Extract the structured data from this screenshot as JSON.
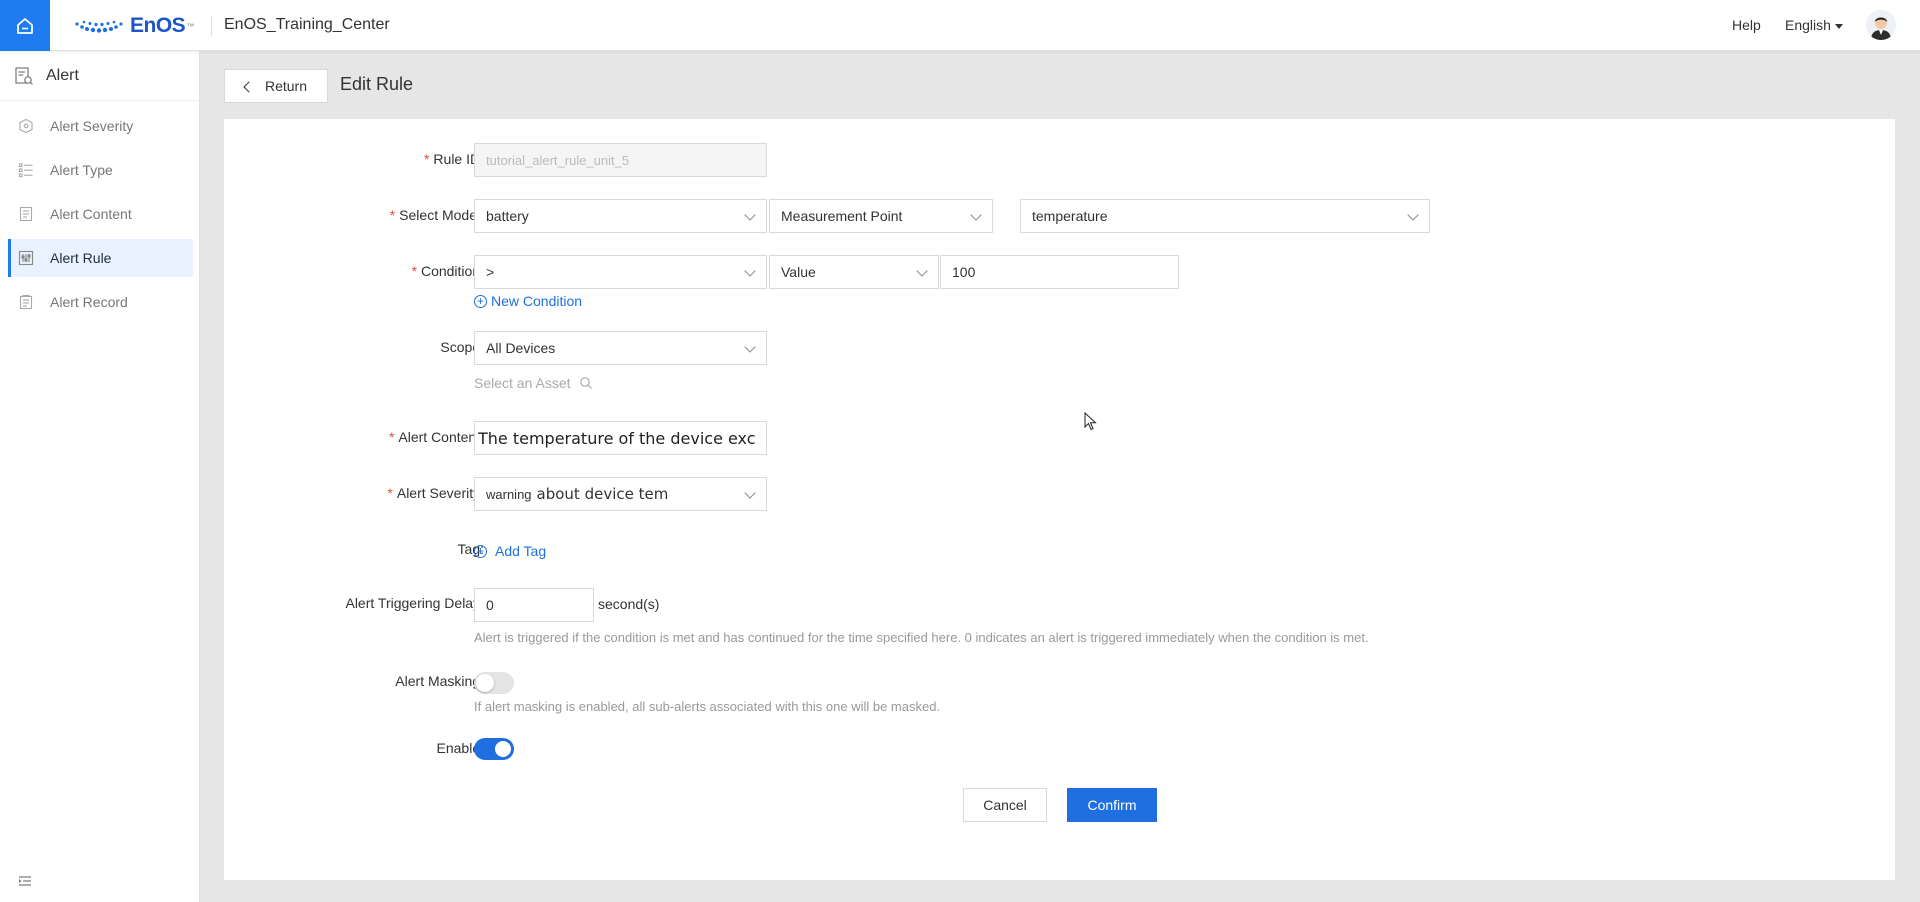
{
  "header": {
    "logo_text": "EnOS",
    "logo_tm": "™",
    "app_title": "EnOS_Training_Center",
    "help_label": "Help",
    "language": "English"
  },
  "sidebar": {
    "title": "Alert",
    "items": [
      {
        "label": "Alert Severity",
        "icon": "severity-icon"
      },
      {
        "label": "Alert Type",
        "icon": "list-icon"
      },
      {
        "label": "Alert Content",
        "icon": "document-icon"
      },
      {
        "label": "Alert Rule",
        "icon": "rule-icon",
        "active": true
      },
      {
        "label": "Alert Record",
        "icon": "record-icon"
      }
    ]
  },
  "page": {
    "return_label": "Return",
    "title": "Edit Rule"
  },
  "form": {
    "rule_id": {
      "label": "Rule ID",
      "value": "tutorial_alert_rule_unit_5"
    },
    "select_model": {
      "label": "Select Model",
      "model": "battery",
      "point_type": "Measurement Point",
      "point": "temperature"
    },
    "condition": {
      "label": "Condition",
      "operator": ">",
      "type": "Value",
      "value": "100",
      "new_condition": "New Condition"
    },
    "scope": {
      "label": "Scope",
      "value": "All Devices",
      "select_asset": "Select an Asset"
    },
    "alert_content": {
      "label": "Alert Content",
      "value": "The temperature of the device exc"
    },
    "alert_severity": {
      "label": "Alert Severity",
      "value_small": "warning",
      "value_large": "about device tem"
    },
    "tag": {
      "label": "Tag",
      "add_label": "Add Tag"
    },
    "delay": {
      "label": "Alert Triggering Delay",
      "value": "0",
      "unit": "second(s)",
      "hint": "Alert is triggered if the condition is met and has continued for the time specified here. 0 indicates an alert is triggered immediately when the condition is met."
    },
    "masking": {
      "label": "Alert Masking",
      "enabled": false,
      "hint": "If alert masking is enabled, all sub-alerts associated with this one will be masked."
    },
    "enable": {
      "label": "Enable",
      "enabled": true
    },
    "colon": ":"
  },
  "actions": {
    "cancel": "Cancel",
    "confirm": "Confirm"
  },
  "colors": {
    "primary": "#1f6fe0",
    "home_bg": "#1f7bf0",
    "required": "#e74c3c"
  }
}
